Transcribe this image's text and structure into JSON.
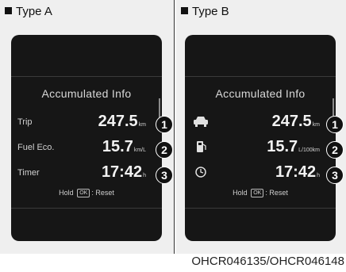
{
  "colors": {
    "screen": "#161616",
    "text": "#f2f2f2",
    "background": "#efefef"
  },
  "type_a": {
    "label": "Type A",
    "title": "Accumulated Info",
    "rows": [
      {
        "label": "Trip",
        "value": "247.5",
        "unit": "km",
        "callout": "1"
      },
      {
        "label": "Fuel Eco.",
        "value": "15.7",
        "unit": "km/L",
        "callout": "2"
      },
      {
        "label": "Timer",
        "value": "17:42",
        "unit": "h",
        "callout": "3"
      }
    ],
    "hold_prefix": "Hold",
    "ok": "OK",
    "hold_suffix": ": Reset"
  },
  "type_b": {
    "label": "Type B",
    "title": "Accumulated Info",
    "rows": [
      {
        "icon": "car-icon",
        "value": "247.5",
        "unit": "km",
        "callout": "1"
      },
      {
        "icon": "fuel-pump-icon",
        "value": "15.7",
        "unit": "L/100km",
        "callout": "2"
      },
      {
        "icon": "clock-icon",
        "value": "17:42",
        "unit": "h",
        "callout": "3"
      }
    ],
    "hold_prefix": "Hold",
    "ok": "OK",
    "hold_suffix": ": Reset"
  },
  "caption": "OHCR046135/OHCR046148"
}
